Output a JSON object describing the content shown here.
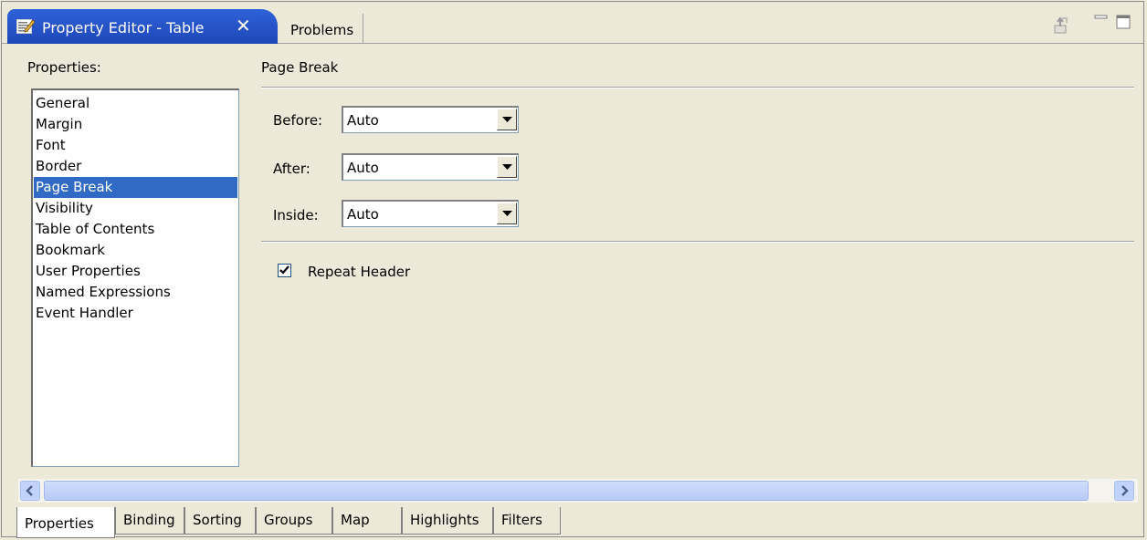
{
  "tabs": {
    "active_label": "Property Editor - Table",
    "inactive_label": "Problems"
  },
  "properties": {
    "caption": "Properties:",
    "items": [
      "General",
      "Margin",
      "Font",
      "Border",
      "Page Break",
      "Visibility",
      "Table of Contents",
      "Bookmark",
      "User Properties",
      "Named Expressions",
      "Event Handler"
    ],
    "selected": "Page Break"
  },
  "section": {
    "title": "Page Break",
    "before_label": "Before:",
    "before_value": "Auto",
    "after_label": "After:",
    "after_value": "Auto",
    "inside_label": "Inside:",
    "inside_value": "Auto",
    "repeat_header_label": "Repeat Header",
    "repeat_header_checked": true
  },
  "bottom_tabs": [
    "Properties",
    "Binding",
    "Sorting",
    "Groups",
    "Map",
    "Highlights",
    "Filters"
  ],
  "bottom_tab_active": "Properties",
  "colors": {
    "accent": "#316ac5",
    "tab_active": "#2f62d8",
    "background": "#ece9d8"
  },
  "icons": {
    "tab_icon": "property-editor-icon",
    "close": "close-icon",
    "export": "export-icon",
    "minimize": "minimize-icon",
    "maximize": "maximize-icon"
  }
}
